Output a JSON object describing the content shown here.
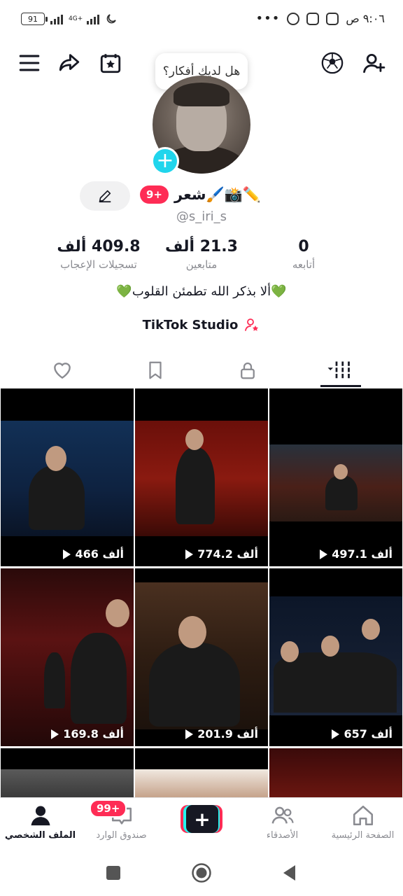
{
  "status_bar": {
    "time": "٩:٠٦ ص",
    "battery": "91",
    "network": "4G+"
  },
  "thought_bubble": "هل لديك أفكار؟",
  "profile": {
    "display_name": "شعر🖌️📸✏️",
    "notification_badge": "9+",
    "username": "@s_iri_s",
    "bio": "💚ألا بذكر الله تطمئن القلوب💚",
    "studio_label": "TikTok Studio"
  },
  "stats": [
    {
      "value": "0",
      "label": "أتابعه"
    },
    {
      "value": "21.3 ألف",
      "label": "متابعين"
    },
    {
      "value": "409.8 ألف",
      "label": "تسجيلات الإعجاب"
    }
  ],
  "tabs": {
    "videos_icon": "grid-icon",
    "private_icon": "lock-icon",
    "saved_icon": "bookmark-icon",
    "liked_icon": "heart-icon"
  },
  "videos": [
    {
      "views": "497.1 ألف"
    },
    {
      "views": "774.2 ألف"
    },
    {
      "views": "466 ألف"
    },
    {
      "views": "657 ألف"
    },
    {
      "views": "201.9 ألف"
    },
    {
      "views": "169.8 ألف"
    }
  ],
  "bottom_nav": {
    "home": "الصفحة الرئيسية",
    "friends": "الأصدقاء",
    "inbox": "صندوق الوارد",
    "inbox_badge": "99+",
    "profile": "الملف الشخصي"
  },
  "colors": {
    "accent": "#fe2c55",
    "cyan": "#20d5ec",
    "text": "#161823",
    "muted": "#8a8b91"
  }
}
